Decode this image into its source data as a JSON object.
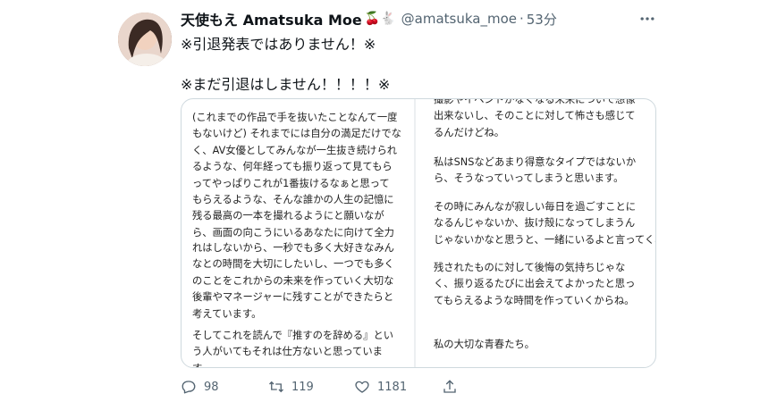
{
  "tweet": {
    "author_name": "天使もえ Amatsuka Moe",
    "author_emoji": "🍒🐇",
    "handle": "@amatsuka_moe",
    "separator": "·",
    "time": "53分",
    "text_line_1": "※引退発表ではありません！※",
    "text_line_2": "※まだ引退はしません！！！！※"
  },
  "media": {
    "left_para_1": "(これまでの作品で手を抜いたことなんて一度\nもないけど) それまでには自分の満足だけでな\nく、AV女優としてみんなが一生抜き続けられ\nるような、何年経っても振り返って見てもら\nってやっぱりこれが1番抜けるなぁと思って\nもらえるような、そんな誰かの人生の記憶に\n残る最高の一本を撮れるようにと願いなが\nら、画面の向こうにいるあなたに向けて全力",
    "left_para_2": "れはしないから、一秒でも多く大好きなみん\nなとの時間を大切にしたいし、一つでも多く\nのことをこれからの未来を作っていく大切な\n後輩やマネージャーに残すことができたらと\n考えています。",
    "left_para_3": "そしてこれを読んで『推すのを辞める』とい\nう人がいてもそれは仕方ないと思っていま\nす。",
    "right_para_1": "撮影やイベントがなくなる未来について想像\n出来ないし、そのことに対して怖さも感じて\nるんだけどね。",
    "right_para_2": "私はSNSなどあまり得意なタイプではないか\nら、そうなっていってしまうと思います。",
    "right_para_3": "その時にみんなが寂しい毎日を過ごすことに\nなるんじゃないか、抜け殻になってしまうん\nじゃないかなと思うと、一緒にいるよと言ってくれるみんなへは",
    "right_para_4": "残されたものに対して後悔の気持ちじゃな\nく、振り返るたびに出会えてよかったと思っ\nてもらえるような時間を作っていくからね。",
    "right_para_5": "私の大切な青春たち。"
  },
  "actions": {
    "replies": "98",
    "retweets": "119",
    "likes": "1181"
  },
  "icons": [
    "avatar",
    "more-icon",
    "reply-icon",
    "retweet-icon",
    "like-icon",
    "share-icon"
  ],
  "colors": {
    "text": "#0f1419",
    "secondary": "#536471",
    "border": "#cfd9de"
  }
}
